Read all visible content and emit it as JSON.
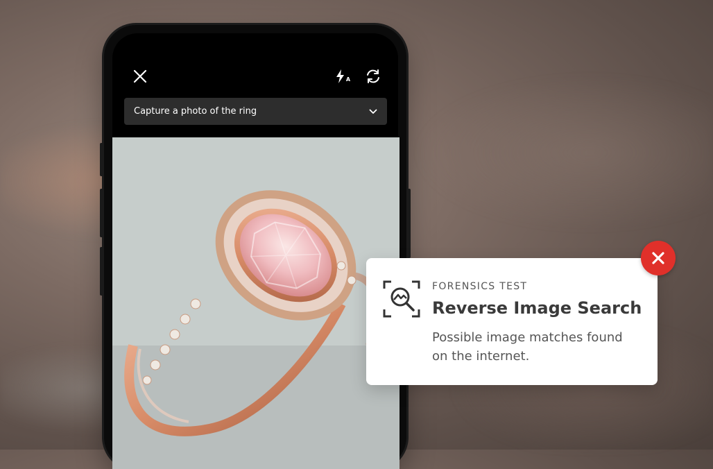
{
  "camera": {
    "prompt_label": "Capture a photo of the ring",
    "flash_badge": "A"
  },
  "forensics_card": {
    "eyebrow": "FORENSICS TEST",
    "title": "Reverse Image Search",
    "description": "Possible image matches found on the internet.",
    "status": "failed"
  },
  "colors": {
    "alert_red": "#E0302A",
    "card_bg": "#FFFFFF",
    "prompt_bar_bg": "#2D2D2D"
  },
  "icons": {
    "close": "close-icon",
    "flash": "flash-auto-icon",
    "flip": "flip-camera-icon",
    "dropdown": "chevron-down-icon",
    "forensics": "image-search-icon",
    "alert": "x-circle-icon"
  }
}
